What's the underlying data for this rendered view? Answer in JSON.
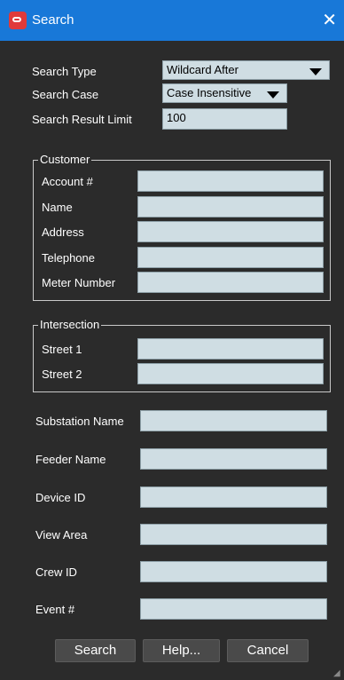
{
  "window": {
    "title": "Search",
    "close_glyph": "✕"
  },
  "search": {
    "type_label": "Search Type",
    "type_value": "Wildcard After",
    "case_label": "Search Case",
    "case_value": "Case Insensitive",
    "limit_label": "Search Result Limit",
    "limit_value": "100"
  },
  "customer": {
    "legend": "Customer",
    "fields": [
      {
        "label": "Account #",
        "value": ""
      },
      {
        "label": "Name",
        "value": ""
      },
      {
        "label": "Address",
        "value": ""
      },
      {
        "label": "Telephone",
        "value": ""
      },
      {
        "label": "Meter Number",
        "value": ""
      }
    ]
  },
  "intersection": {
    "legend": "Intersection",
    "fields": [
      {
        "label": "Street 1",
        "value": ""
      },
      {
        "label": "Street 2",
        "value": ""
      }
    ]
  },
  "other": {
    "fields": [
      {
        "label": "Substation Name",
        "value": ""
      },
      {
        "label": "Feeder Name",
        "value": ""
      },
      {
        "label": "Device ID",
        "value": ""
      },
      {
        "label": "View Area",
        "value": ""
      },
      {
        "label": "Crew ID",
        "value": ""
      },
      {
        "label": "Event #",
        "value": ""
      }
    ]
  },
  "buttons": {
    "search": "Search",
    "help": "Help...",
    "cancel": "Cancel"
  },
  "colors": {
    "titlebar": "#1878d8",
    "background": "#2b2b2b",
    "field": "#cfdde3",
    "logo": "#e03a3a"
  }
}
